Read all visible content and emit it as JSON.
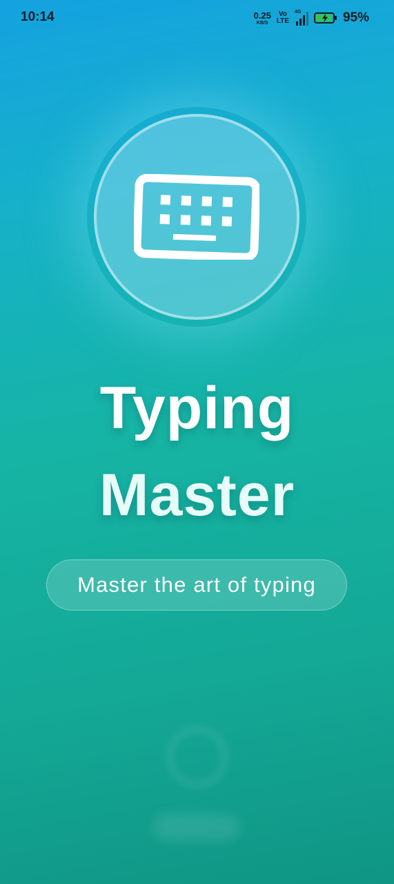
{
  "status_bar": {
    "time": "10:14",
    "net_speed_value": "0.25",
    "net_speed_unit": "KB/S",
    "volte_top": "Vo",
    "volte_bottom": "LTE",
    "network_type": "4G",
    "battery_percent_text": "95%",
    "battery_level": 0.95,
    "icons": [
      "net-speed",
      "volte-icon",
      "signal-icon",
      "battery-charging-icon"
    ]
  },
  "splash": {
    "logo_icon": "keyboard-icon",
    "title_line1": "Typing",
    "title_line2": "Master",
    "tagline": "Master the art of typing",
    "loading_indicator": "loading-indicator"
  },
  "colors": {
    "gradient_top": "#14a2e0",
    "gradient_mid": "#16b4a4",
    "gradient_bottom": "#109584",
    "battery_fill": "#35c54f",
    "text": "#ffffff"
  }
}
